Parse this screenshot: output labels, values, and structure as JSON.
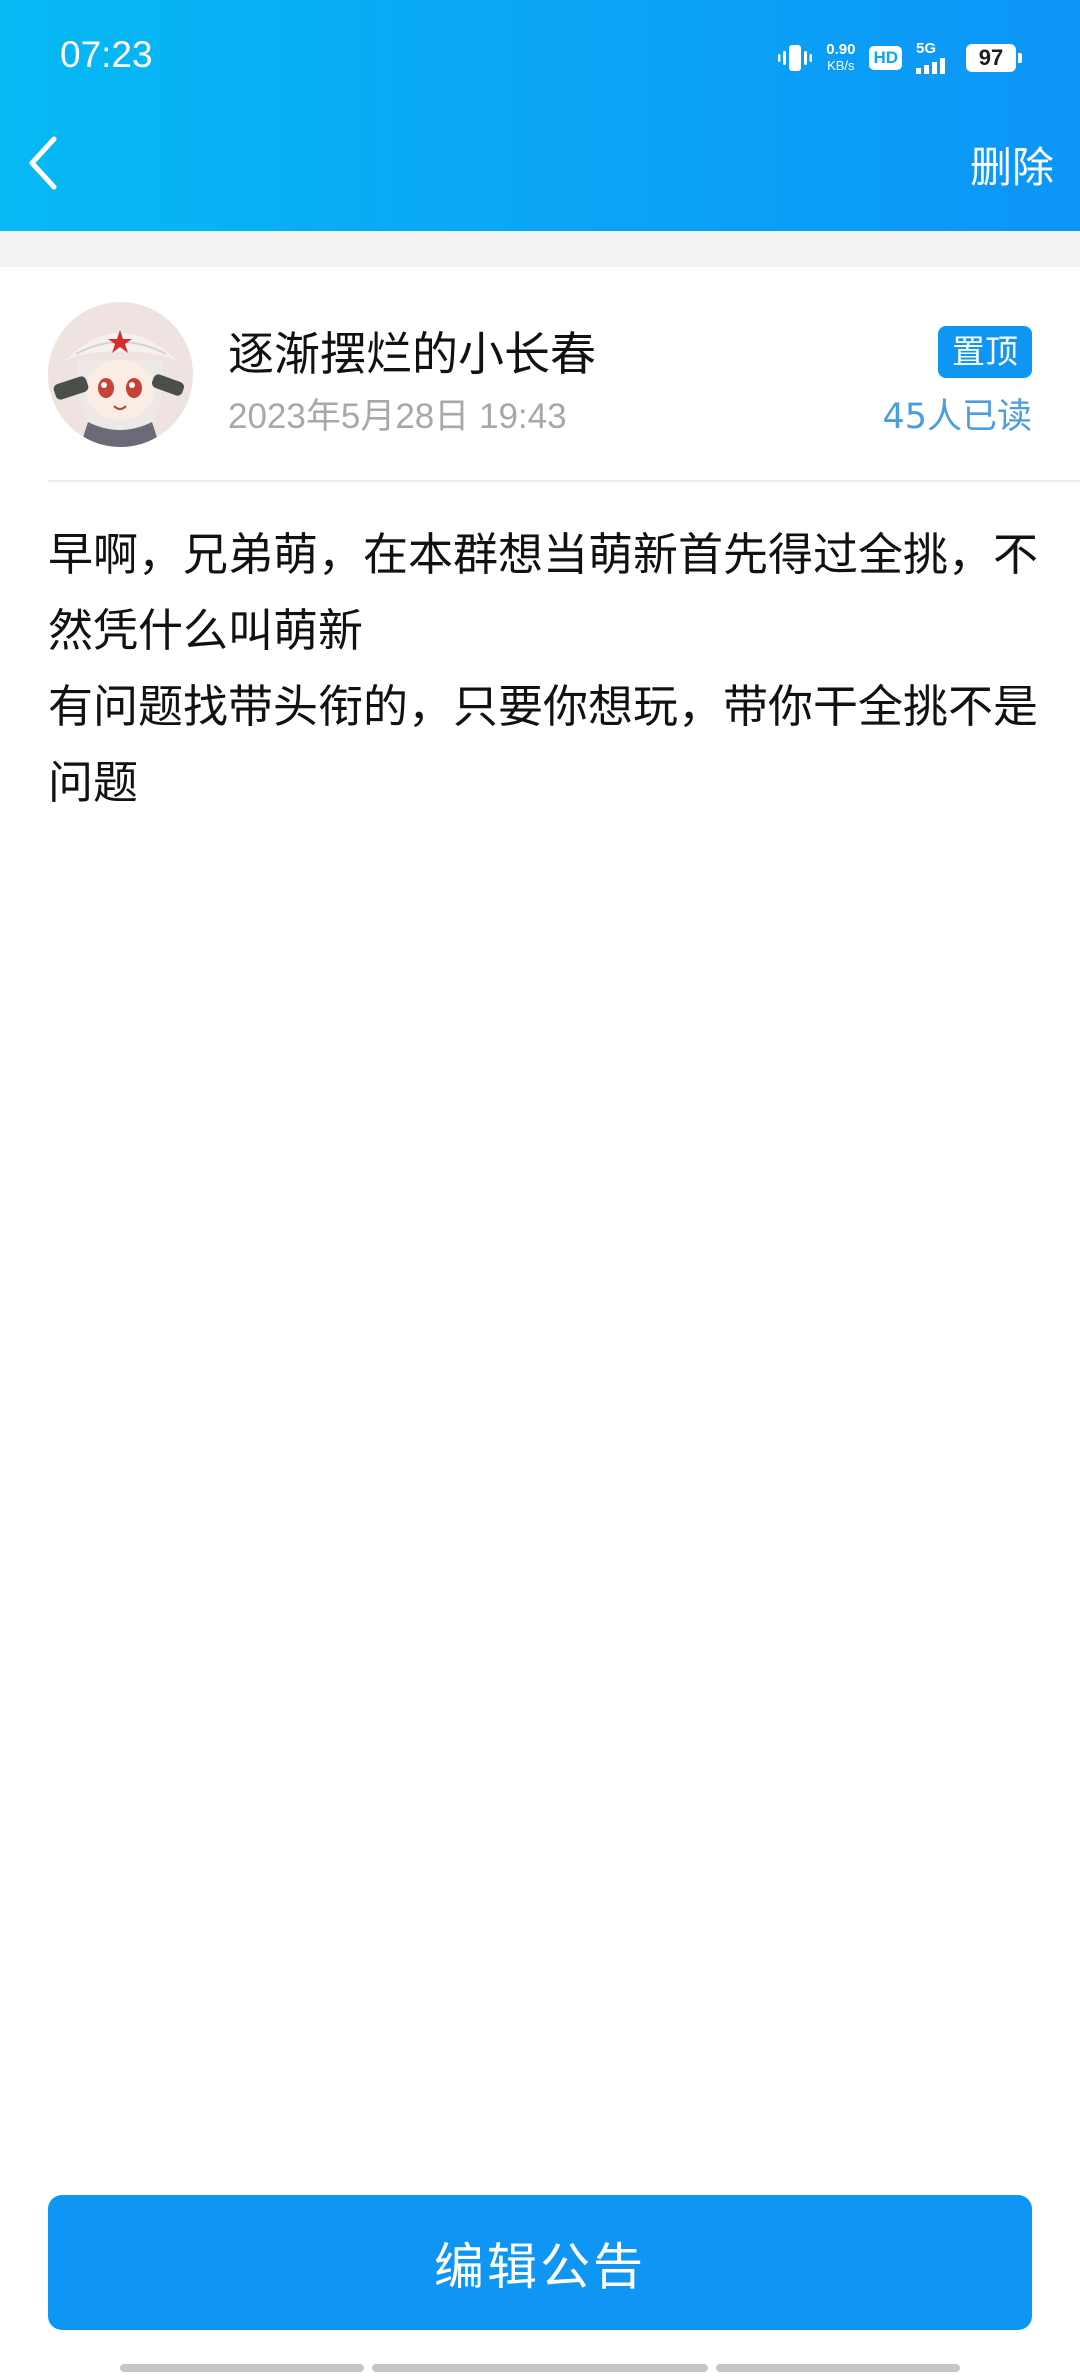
{
  "status_bar": {
    "time": "07:23",
    "net_speed_value": "0.90",
    "net_speed_unit": "KB/s",
    "hd_label": "HD",
    "network_type": "5G",
    "battery": "97",
    "icons": [
      "vibrate-icon",
      "signal-icon",
      "battery-icon"
    ]
  },
  "toolbar": {
    "back_icon": "chevron-left-icon",
    "delete_label": "删除"
  },
  "announcement": {
    "author": "逐渐摆烂的小长春",
    "date": "2023年5月28日 19:43",
    "pin_label": "置顶",
    "read_count": "45人已读",
    "lines": [
      "早啊，兄弟萌，在本群想当萌新首先得过全挑，不然凭什么叫萌新",
      "有问题找带头衔的，只要你想玩，带你干全挑不是问题"
    ]
  },
  "footer": {
    "edit_label": "编辑公告"
  },
  "colors": {
    "accent": "#0f95f3",
    "header_gradient_start": "#06b9f3",
    "header_gradient_end": "#0c95f7",
    "read_count": "#4a9ee0",
    "date_gray": "#a8a8a8"
  }
}
